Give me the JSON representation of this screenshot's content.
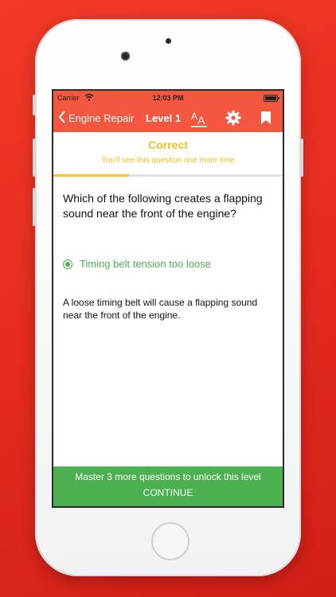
{
  "status_bar": {
    "carrier": "Carrier",
    "time": "12:03 PM"
  },
  "nav": {
    "back_label": "Engine Repair",
    "level_label": "Level 1"
  },
  "result": {
    "title": "Correct",
    "subtitle": "You'll see this question one more time",
    "progress": 0.33
  },
  "question": {
    "text": "Which of the following creates a flapping sound near the front of the engine?",
    "selected_answer": "Timing belt tension too loose",
    "explanation": "A loose timing belt will cause a flapping sound near the front of the engine."
  },
  "footer": {
    "message": "Master 3 more questions to unlock this level",
    "continue_label": "CONTINUE"
  },
  "colors": {
    "background": "#e22b1e",
    "navbar": "#f35740",
    "correct": "#f0c020",
    "answer_green": "#4caf50"
  },
  "icons": [
    "wifi-icon",
    "battery-icon",
    "chevron-left-icon",
    "font-size-icon",
    "gear-icon",
    "bookmark-icon",
    "radio-selected-icon"
  ]
}
